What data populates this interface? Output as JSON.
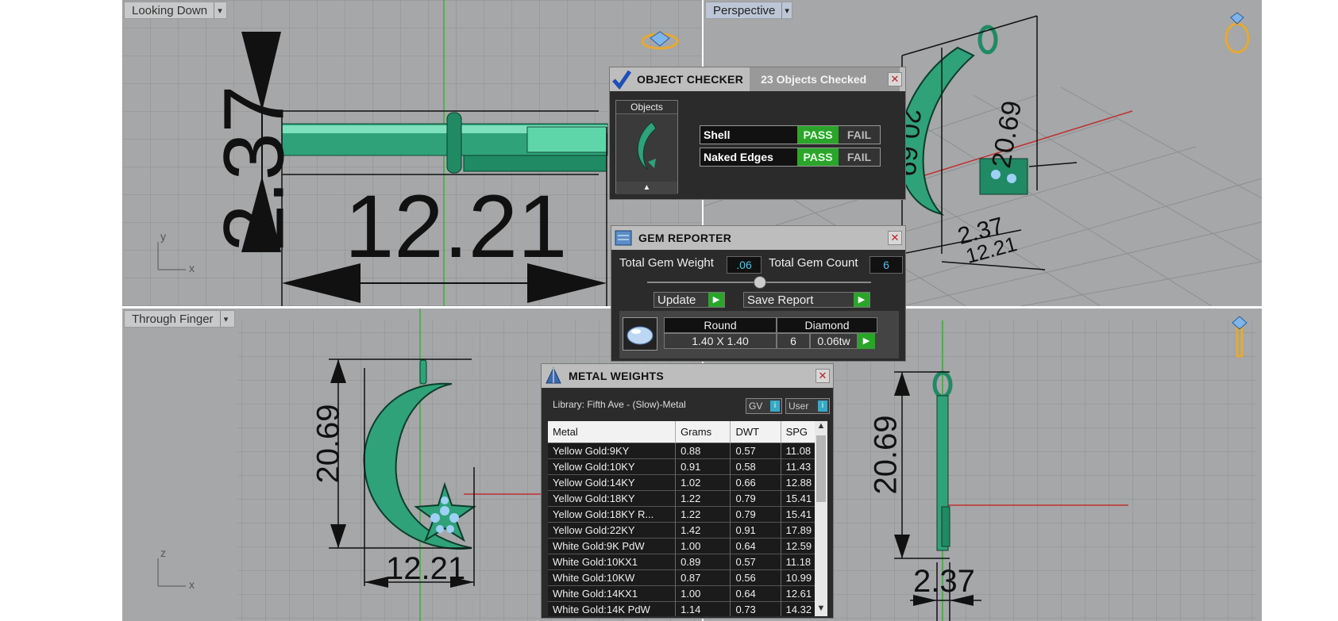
{
  "viewports": {
    "top_left": {
      "label": "Looking Down",
      "dims": {
        "vertical": "2.37",
        "horizontal": "12.21"
      },
      "axes": {
        "a": "y",
        "b": "x"
      }
    },
    "top_right": {
      "label": "Perspective",
      "dims": {
        "d1": "20.69",
        "d2": "20.69",
        "d3": "2.37",
        "d4": "12.21"
      }
    },
    "bottom_left": {
      "label": "Through Finger",
      "dims": {
        "vertical": "20.69",
        "horizontal": "12.21"
      },
      "axes": {
        "a": "z",
        "b": "x"
      }
    },
    "bottom_right": {
      "dims": {
        "vertical": "20.69",
        "horizontal": "2.37"
      }
    }
  },
  "object_checker": {
    "title": "OBJECT CHECKER",
    "subtitle": "23  Objects Checked",
    "objects_label": "Objects",
    "checks": [
      {
        "name": "Shell",
        "pass": "PASS",
        "fail": "FAIL"
      },
      {
        "name": "Naked Edges",
        "pass": "PASS",
        "fail": "FAIL"
      }
    ]
  },
  "gem_reporter": {
    "title": "GEM REPORTER",
    "total_gem_weight_label": "Total Gem Weight",
    "total_gem_weight": ".06",
    "total_gem_count_label": "Total Gem Count",
    "total_gem_count": "6",
    "update_label": "Update",
    "save_report_label": "Save Report",
    "gem": {
      "shape": "Round",
      "type": "Diamond",
      "size": "1.40 X 1.40",
      "count": "6",
      "weight": "0.06tw"
    }
  },
  "metal_weights": {
    "title": "METAL WEIGHTS",
    "library": "Library: Fifth Ave - (Slow)-Metal",
    "gv_label": "GV",
    "user_label": "User",
    "columns": [
      "Metal",
      "Grams",
      "DWT",
      "SPG"
    ],
    "rows": [
      [
        "Yellow Gold:9KY",
        "0.88",
        "0.57",
        "11.08"
      ],
      [
        "Yellow Gold:10KY",
        "0.91",
        "0.58",
        "11.43"
      ],
      [
        "Yellow Gold:14KY",
        "1.02",
        "0.66",
        "12.88"
      ],
      [
        "Yellow Gold:18KY",
        "1.22",
        "0.79",
        "15.41"
      ],
      [
        "Yellow Gold:18KY R...",
        "1.22",
        "0.79",
        "15.41"
      ],
      [
        "Yellow Gold:22KY",
        "1.42",
        "0.91",
        "17.89"
      ],
      [
        "White Gold:9K PdW",
        "1.00",
        "0.64",
        "12.59"
      ],
      [
        "White Gold:10KX1",
        "0.89",
        "0.57",
        "11.18"
      ],
      [
        "White Gold:10KW",
        "0.87",
        "0.56",
        "10.99"
      ],
      [
        "White Gold:14KX1",
        "1.00",
        "0.64",
        "12.61"
      ],
      [
        "White Gold:14K PdW",
        "1.14",
        "0.73",
        "14.32"
      ]
    ]
  },
  "colors": {
    "jewel_green": "#2fa27a",
    "pass_green": "#2aa52a",
    "value_blue": "#4ec3f4",
    "viewport_gray": "#a5a7a9",
    "icon_gold": "#e8a92f"
  }
}
